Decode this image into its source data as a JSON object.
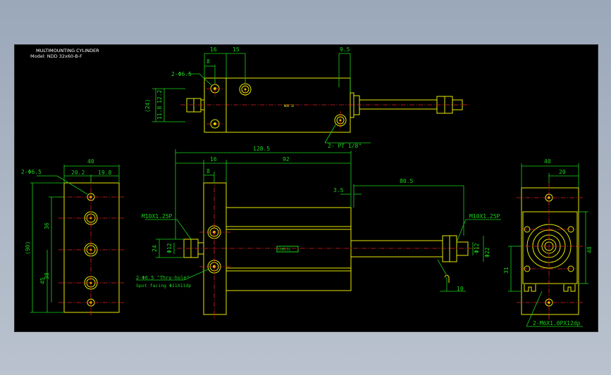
{
  "title_block": {
    "heading": "MULTIMOUNTING CYLINDER",
    "model": "Model: NDD 32x60-B-F"
  },
  "top_view": {
    "dims": {
      "d16": "16",
      "d15": "15",
      "d8": "8",
      "d9_5": "9.5",
      "d24": "(24)",
      "d12_2": "12.2",
      "d11_8": "11.8"
    },
    "callouts": {
      "holes": "2-Φ6.5",
      "ports": "2- PT 1/8\""
    },
    "center_label": "NDD 32"
  },
  "front_view": {
    "dims": {
      "overall": "128.5",
      "d16": "16",
      "d8": "8",
      "d92": "92",
      "d80_5": "80.5",
      "d3_5": "3.5",
      "d24": "24",
      "d12": "Φ12",
      "d22": "Φ22",
      "d10": "10"
    },
    "callouts": {
      "left_thread": "M10X1.25P",
      "right_thread": "M10X1.25P",
      "holes_1": "2-Φ6.5 \"Thru-hole\"",
      "holes_2": "Spot facing  Φ11X11dp"
    },
    "brand": "CHELIC"
  },
  "left_view": {
    "dims": {
      "d40": "40",
      "d20_2": "20.2",
      "d19_8": "19.8",
      "d36": "36",
      "d38": "38",
      "d90": "(90)",
      "d45": "45"
    },
    "callouts": {
      "holes": "2-Φ6.5"
    }
  },
  "right_view": {
    "dims": {
      "d40": "40",
      "d20": "20",
      "d48": "48",
      "d31": "31"
    },
    "callouts": {
      "taps": "2-M6X1.0PX12dp"
    }
  },
  "colors": {
    "background": "#000000",
    "outline": "#e8e800",
    "dimension": "#19d419",
    "centerline": "#e02020",
    "text": "#ffffff"
  }
}
